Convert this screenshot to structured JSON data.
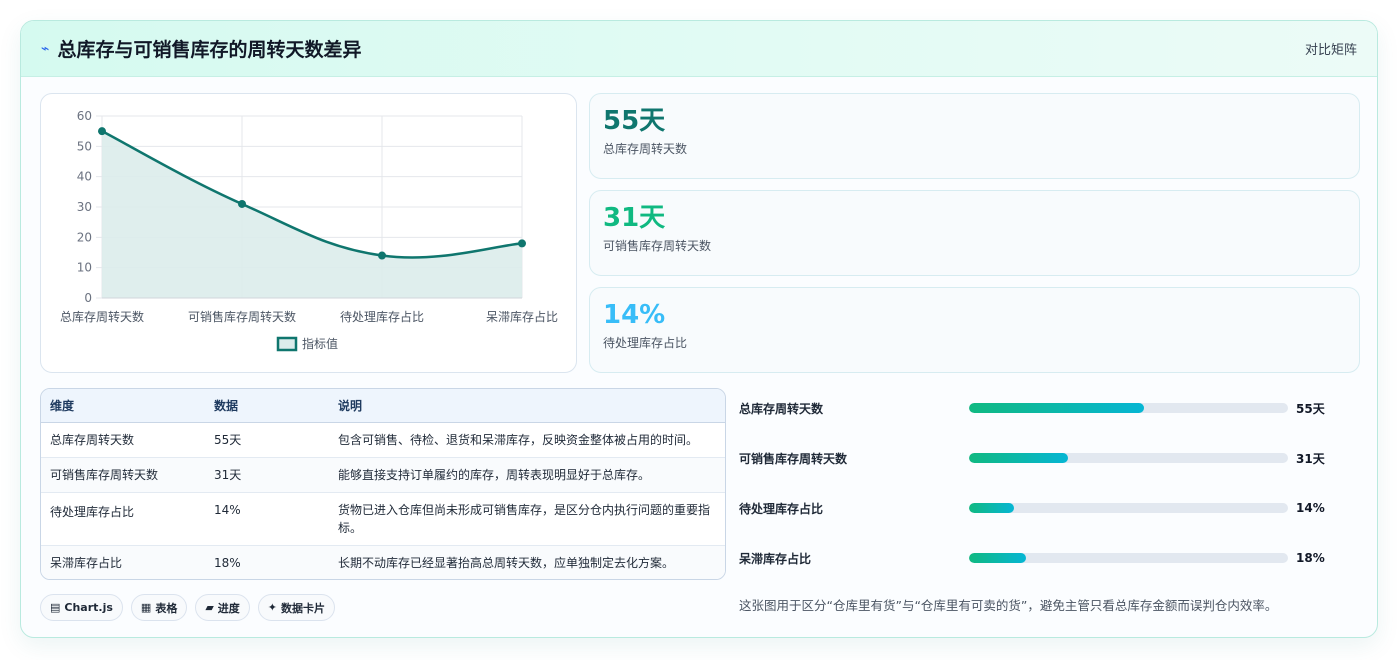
{
  "header": {
    "icon": "bolt-icon",
    "title": "总库存与可销售库存的周转天数差异",
    "tag": "对比矩阵"
  },
  "chart_data": {
    "type": "line",
    "categories": [
      "总库存周转天数",
      "可销售库存周转天数",
      "待处理库存占比",
      "呆滞库存占比"
    ],
    "series": [
      {
        "name": "指标值",
        "values": [
          55,
          31,
          14,
          18
        ],
        "color": "#0f766e",
        "fill": "#dbeceb"
      }
    ],
    "yticks": [
      "0",
      "10",
      "20",
      "30",
      "40",
      "50",
      "60"
    ],
    "ylim": [
      0,
      60
    ],
    "grid": true,
    "legend": "bottom",
    "legend_label": "指标值"
  },
  "stats": [
    {
      "value": "55天",
      "label": "总库存周转天数",
      "color": "#0f766e"
    },
    {
      "value": "31天",
      "label": "可销售库存周转天数",
      "color": "#10b981"
    },
    {
      "value": "14%",
      "label": "待处理库存占比",
      "color": "#38bdf8"
    }
  ],
  "table": {
    "headers": [
      "维度",
      "数据",
      "说明"
    ],
    "rows": [
      [
        "总库存周转天数",
        "55天",
        "包含可销售、待检、退货和呆滞库存，反映资金整体被占用的时间。"
      ],
      [
        "可销售库存周转天数",
        "31天",
        "能够直接支持订单履约的库存，周转表现明显好于总库存。"
      ],
      [
        "待处理库存占比",
        "14%",
        "货物已进入仓库但尚未形成可销售库存，是区分仓内执行问题的重要指标。"
      ],
      [
        "呆滞库存占比",
        "18%",
        "长期不动库存已经显著抬高总周转天数，应单独制定去化方案。"
      ]
    ]
  },
  "chips": [
    {
      "icon": "chart-icon",
      "glyph": "▤",
      "label": "Chart.js"
    },
    {
      "icon": "table-icon",
      "glyph": "▦",
      "label": "表格"
    },
    {
      "icon": "progress-icon",
      "glyph": "▰",
      "label": "进度"
    },
    {
      "icon": "card-icon",
      "glyph": "✦",
      "label": "数据卡片"
    }
  ],
  "bars": [
    {
      "label": "总库存周转天数",
      "value": "55天",
      "fraction": 0.55
    },
    {
      "label": "可销售库存周转天数",
      "value": "31天",
      "fraction": 0.31
    },
    {
      "label": "待处理库存占比",
      "value": "14%",
      "fraction": 0.14
    },
    {
      "label": "呆滞库存占比",
      "value": "18%",
      "fraction": 0.18
    }
  ],
  "note": "这张图用于区分“仓库里有货”与“仓库里有可卖的货”，避免主管只看总库存金额而误判仓内效率。"
}
